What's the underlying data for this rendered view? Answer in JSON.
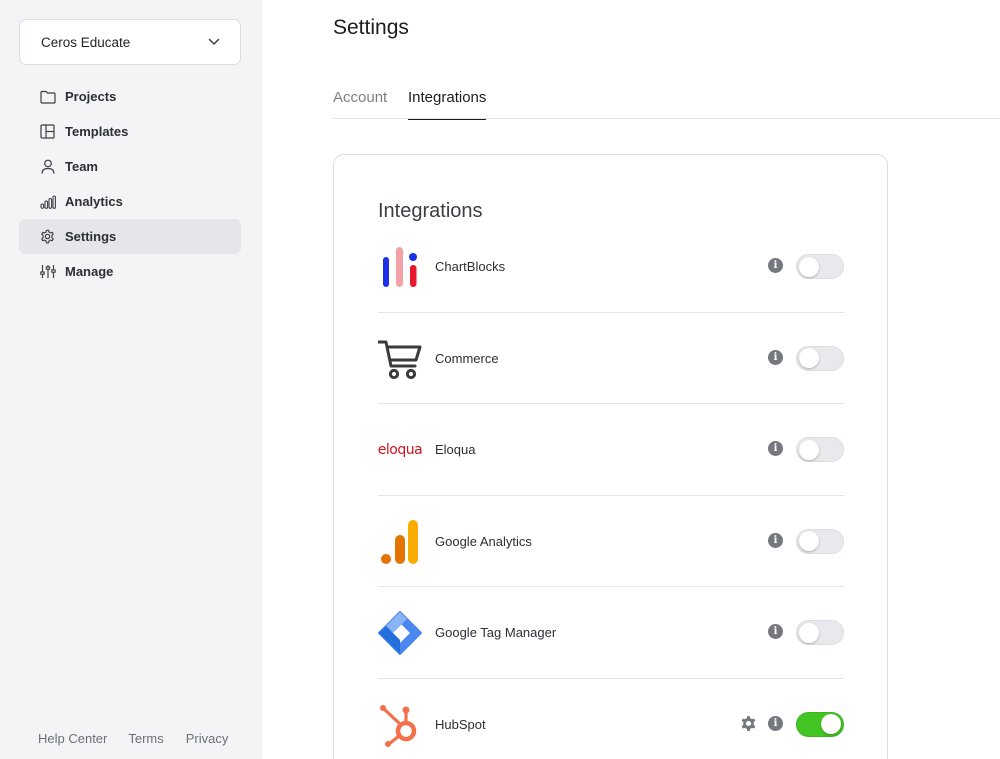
{
  "sidebar": {
    "workspace": "Ceros Educate",
    "items": [
      {
        "label": "Projects",
        "icon": "folder-icon",
        "active": false
      },
      {
        "label": "Templates",
        "icon": "templates-icon",
        "active": false
      },
      {
        "label": "Team",
        "icon": "user-icon",
        "active": false
      },
      {
        "label": "Analytics",
        "icon": "bar-chart-icon",
        "active": false
      },
      {
        "label": "Settings",
        "icon": "gear-icon",
        "active": true
      },
      {
        "label": "Manage",
        "icon": "sliders-icon",
        "active": false
      }
    ],
    "footer": {
      "help": "Help Center",
      "terms": "Terms",
      "privacy": "Privacy"
    }
  },
  "page": {
    "title": "Settings"
  },
  "tabs": {
    "account": "Account",
    "integrations": "Integrations",
    "active": "Integrations"
  },
  "card": {
    "title": "Integrations",
    "integrations": [
      {
        "name": "ChartBlocks",
        "logo": "chartblocks-logo",
        "enabled": false,
        "has_settings": false
      },
      {
        "name": "Commerce",
        "logo": "shopping-cart-icon",
        "enabled": false,
        "has_settings": false
      },
      {
        "name": "Eloqua",
        "logo": "eloqua-logo",
        "logo_text": "eloqua",
        "enabled": false,
        "has_settings": false
      },
      {
        "name": "Google Analytics",
        "logo": "google-analytics-logo",
        "enabled": false,
        "has_settings": false
      },
      {
        "name": "Google Tag Manager",
        "logo": "google-tag-manager-logo",
        "enabled": false,
        "has_settings": false
      },
      {
        "name": "HubSpot",
        "logo": "hubspot-logo",
        "enabled": true,
        "has_settings": true
      }
    ],
    "info_glyph": "i"
  },
  "colors": {
    "toggle_on": "#43c524",
    "toggle_off": "#e8e9ec",
    "sidebar_bg": "#f3f4f6",
    "active_item_bg": "#e4e6ea"
  }
}
